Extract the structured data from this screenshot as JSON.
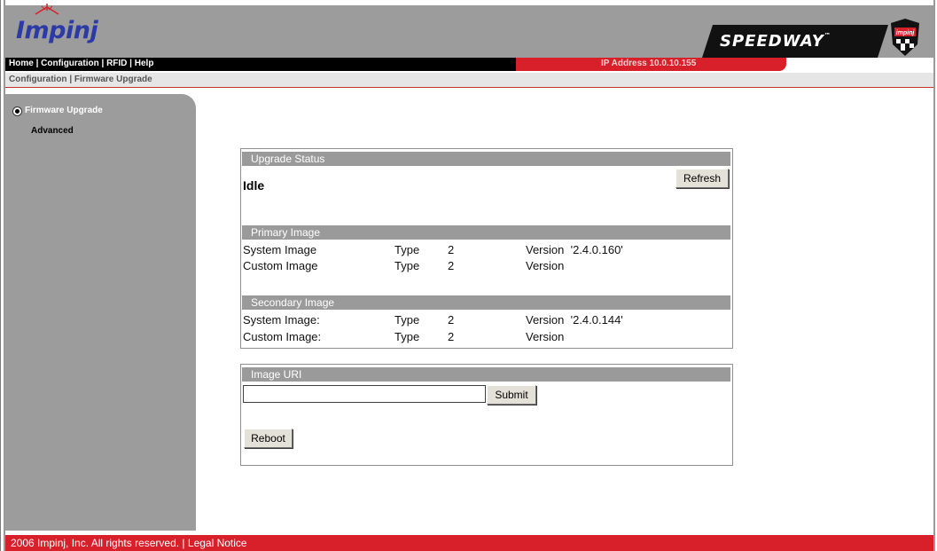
{
  "header": {
    "logo_text": "Impinj",
    "product_text": "Speedway",
    "product_tm": "™",
    "badge_text": "impinj",
    "colors": {
      "banner": "#9c9c9c",
      "accent_red": "#d7202a",
      "logo_blue": "#2c3aa6"
    }
  },
  "nav": {
    "home": "Home",
    "sep1": " | ",
    "configuration": "Configuration",
    "sep2": " | ",
    "rfid": "RFID",
    "sep3": " | ",
    "help": "Help",
    "ip_address": "IP Address 10.0.10.155"
  },
  "breadcrumb": {
    "section": "Configuration",
    "sep": " | ",
    "page": "Firmware Upgrade"
  },
  "sidebar": {
    "items": [
      {
        "label": "Firmware Upgrade",
        "selected": true
      },
      {
        "label": "Advanced",
        "selected": false
      }
    ]
  },
  "upgrade_status": {
    "heading": "Upgrade Status",
    "status": "Idle",
    "refresh_label": "Refresh"
  },
  "primary_image": {
    "heading": "Primary Image",
    "rows": [
      {
        "name": "System Image",
        "type_label": "Type",
        "type": "2",
        "version_label": "Version",
        "version": "'2.4.0.160'"
      },
      {
        "name": "Custom Image",
        "type_label": "Type",
        "type": "2",
        "version_label": "Version",
        "version": ""
      }
    ]
  },
  "secondary_image": {
    "heading": "Secondary Image",
    "rows": [
      {
        "name": "System Image:",
        "type_label": "Type",
        "type": "2",
        "version_label": "Version",
        "version": "'2.4.0.144'"
      },
      {
        "name": "Custom Image:",
        "type_label": "Type",
        "type": "2",
        "version_label": "Version",
        "version": ""
      }
    ]
  },
  "image_uri": {
    "heading": "Image URI",
    "value": "",
    "submit_label": "Submit",
    "reboot_label": "Reboot"
  },
  "footer": {
    "copyright": "2006 Impinj, Inc. All rights reserved.",
    "sep": " | ",
    "legal": "Legal Notice"
  }
}
